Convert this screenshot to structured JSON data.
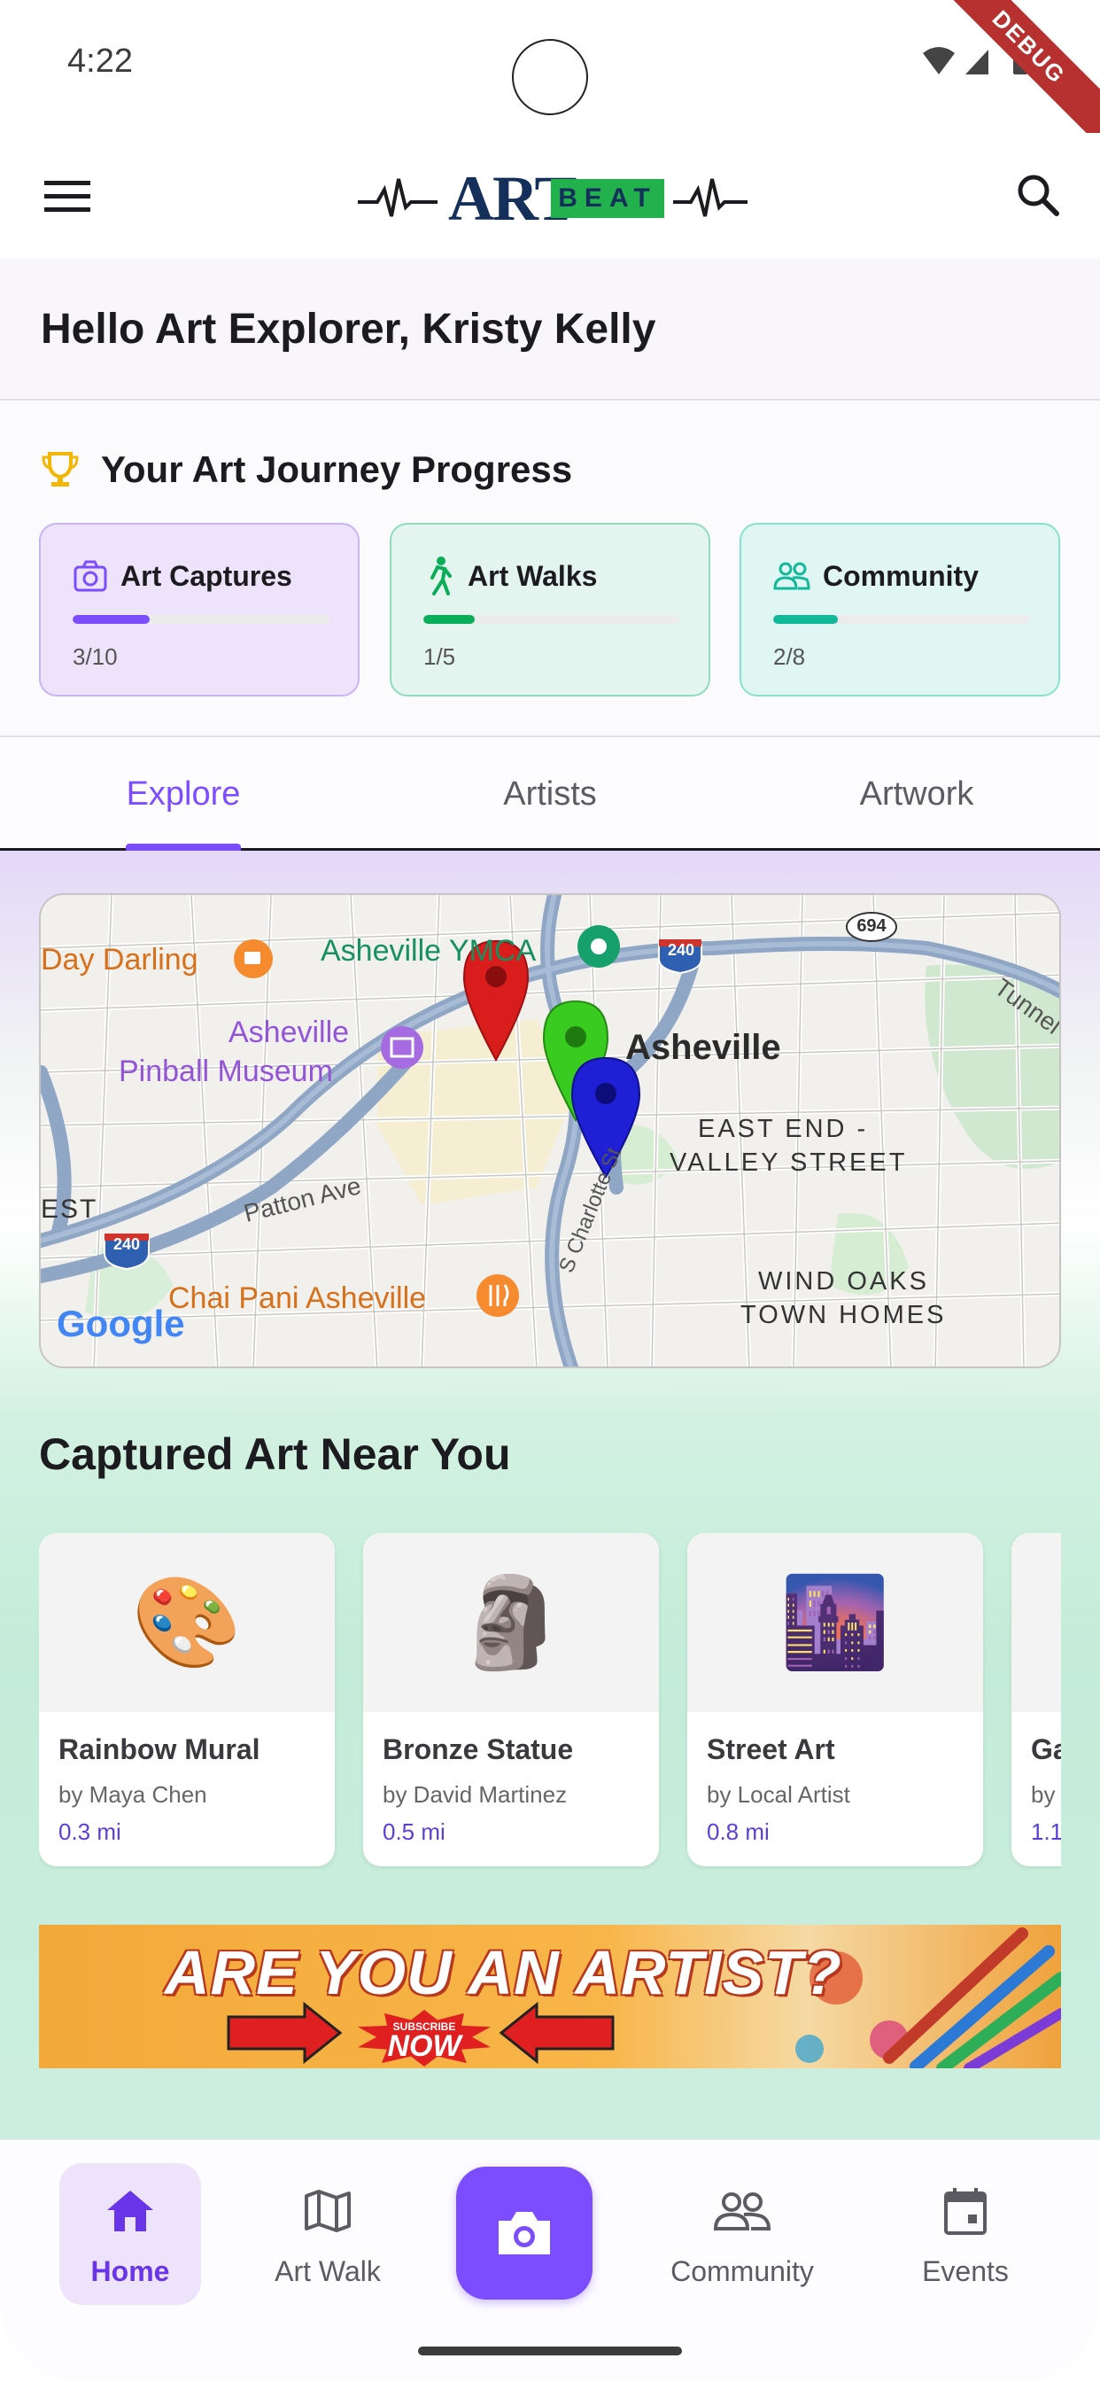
{
  "status_bar": {
    "time": "4:22",
    "debug_label": "DEBUG"
  },
  "app_bar": {
    "logo_art": "ART",
    "logo_beat": "BEAT",
    "menu_icon": "hamburger-menu-icon",
    "search_icon": "search-icon"
  },
  "greeting": {
    "text": "Hello Art Explorer, Kristy Kelly"
  },
  "progress": {
    "title": "Your Art Journey Progress",
    "cards": [
      {
        "label": "Art Captures",
        "count": "3/10",
        "fraction": 0.3,
        "icon": "camera-icon",
        "accent": "#7c4dff"
      },
      {
        "label": "Art Walks",
        "count": "1/5",
        "fraction": 0.2,
        "icon": "walking-person-icon",
        "accent": "#0bae58"
      },
      {
        "label": "Community",
        "count": "2/8",
        "fraction": 0.25,
        "icon": "people-icon",
        "accent": "#11b89a"
      }
    ]
  },
  "tabs": [
    {
      "label": "Explore",
      "active": true
    },
    {
      "label": "Artists",
      "active": false
    },
    {
      "label": "Artwork",
      "active": false
    }
  ],
  "map": {
    "labels": {
      "day_darling": "Day Darling",
      "ymca": "Asheville YMCA",
      "museum_1": "Asheville",
      "museum_2": "Pinball Museum",
      "asheville": "Asheville",
      "east_end_1": "EAST END -",
      "east_end_2": "VALLEY STREET",
      "patton": "Patton Ave",
      "est": "EST",
      "chai": "Chai Pani Asheville",
      "charlotte": "S Charlotte St",
      "wind_oaks_1": "WIND OAKS",
      "wind_oaks_2": "TOWN HOMES",
      "tunnel": "Tunnel",
      "hwy_240_a": "240",
      "hwy_240_b": "240",
      "hwy_694": "694",
      "google": "Google"
    },
    "pins": [
      "red-pin",
      "green-pin",
      "blue-pin"
    ]
  },
  "nearby": {
    "title": "Captured Art Near You",
    "items": [
      {
        "emoji": "🎨",
        "title": "Rainbow Mural",
        "artist": "by Maya Chen",
        "distance": "0.3 mi"
      },
      {
        "emoji": "🗿",
        "title": "Bronze Statue",
        "artist": "by David Martinez",
        "distance": "0.5 mi"
      },
      {
        "emoji": "🌆",
        "title": "Street Art",
        "artist": "by Local Artist",
        "distance": "0.8 mi"
      },
      {
        "emoji": "🖼️",
        "title": "Ga",
        "artist": "by",
        "distance": "1.1"
      }
    ]
  },
  "banner": {
    "headline": "ARE YOU AN ARTIST?",
    "subscribe": "SUBSCRIBE",
    "now": "NOW"
  },
  "bottom_nav": {
    "items": [
      {
        "label": "Home",
        "icon": "home-icon",
        "active": true
      },
      {
        "label": "Art Walk",
        "icon": "map-icon",
        "active": false
      },
      {
        "label": "",
        "icon": "camera-icon",
        "active": false
      },
      {
        "label": "Community",
        "icon": "people-icon",
        "active": false
      },
      {
        "label": "Events",
        "icon": "calendar-icon",
        "active": false
      }
    ]
  },
  "colors": {
    "accent": "#7c4dff",
    "green": "#0bae58",
    "teal": "#11b89a",
    "logo_navy": "#14305a",
    "logo_green": "#22b14c"
  }
}
